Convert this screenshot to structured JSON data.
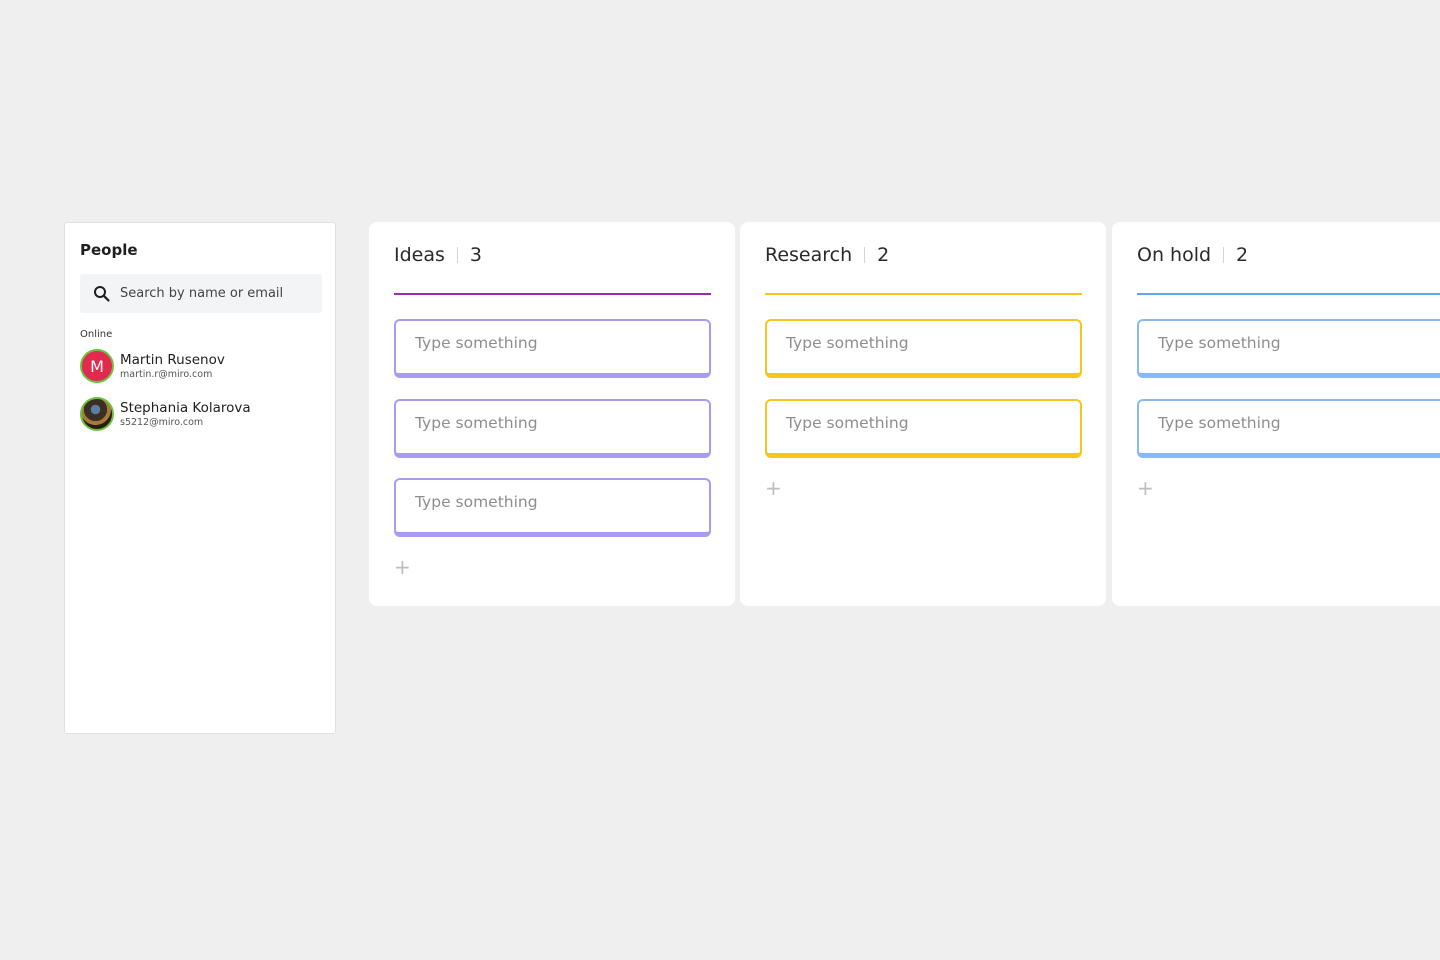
{
  "people": {
    "title": "People",
    "search_placeholder": "Search by name or email",
    "online_label": "Online",
    "users": [
      {
        "initial": "M",
        "name": "Martin Rusenov",
        "email": "martin.r@miro.com",
        "avatar_color": "#e2294f"
      },
      {
        "initial": "",
        "name": "Stephania Kolarova",
        "email": "s5212@miro.com"
      }
    ],
    "status_color": "#6cc23f"
  },
  "board": {
    "columns": [
      {
        "title": "Ideas",
        "count": "3",
        "accent": "#9b2bb0",
        "card_border": "#a89cf2",
        "cards": [
          "Type something",
          "Type something",
          "Type something"
        ],
        "add_label": "+"
      },
      {
        "title": "Research",
        "count": "2",
        "accent": "#f8c51c",
        "card_border": "#f8c51c",
        "cards": [
          "Type something",
          "Type something"
        ],
        "add_label": "+"
      },
      {
        "title": "On hold",
        "count": "2",
        "accent": "#64a3ee",
        "card_border": "#8ab8f3",
        "cards": [
          "Type something",
          "Type something"
        ],
        "add_label": "+"
      }
    ]
  }
}
